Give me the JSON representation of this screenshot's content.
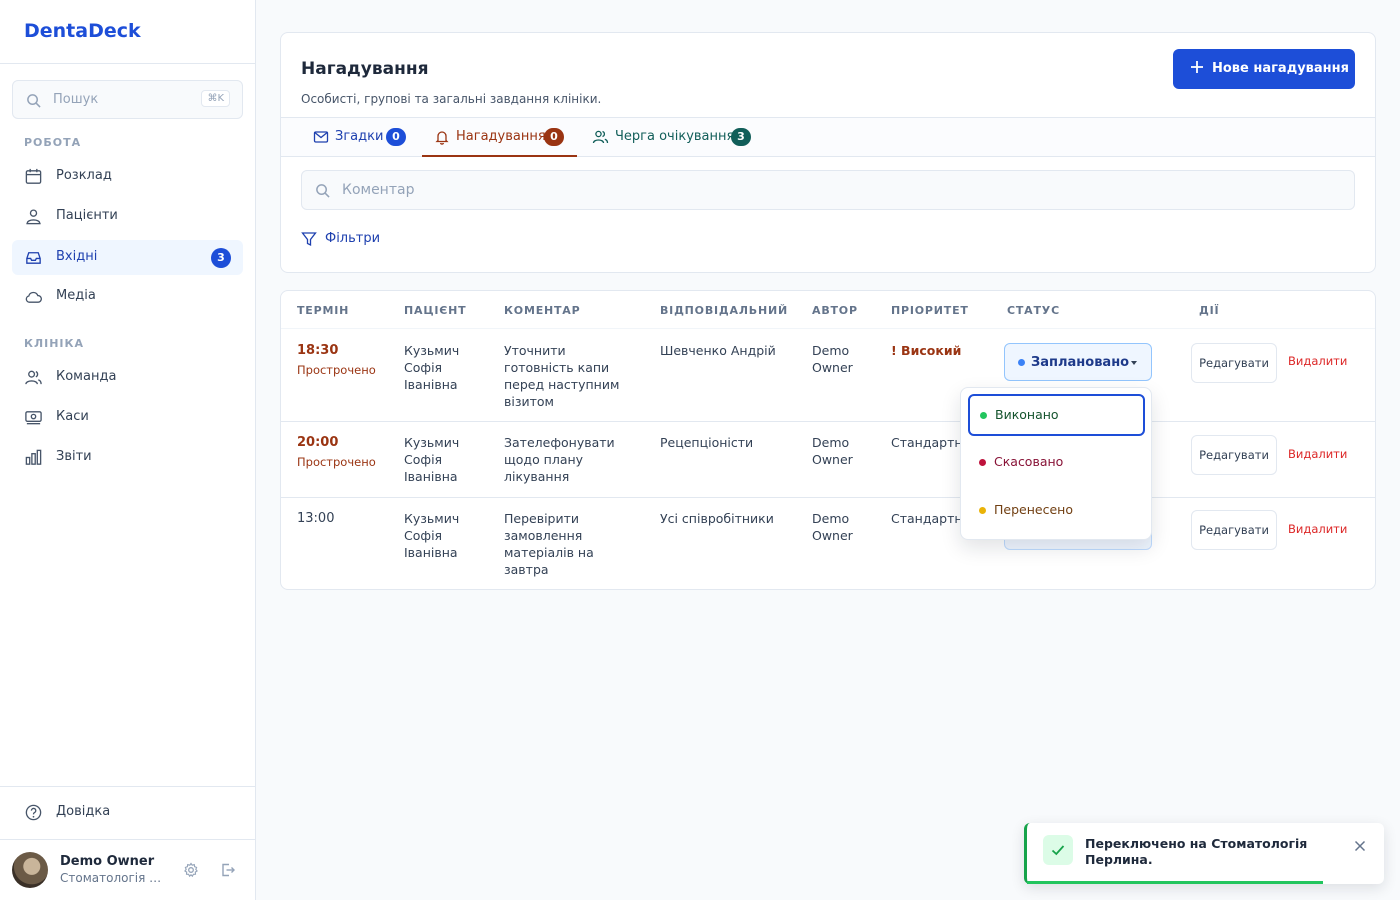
{
  "brand": "DentaDeck",
  "search": {
    "placeholder": "Пошук",
    "shortcut": "⌘K"
  },
  "sidebar": {
    "work_label": "РОБОТА",
    "clinic_label": "КЛІНІКА",
    "items": [
      {
        "label": "Розклад",
        "icon": "calendar-icon"
      },
      {
        "label": "Пацієнти",
        "icon": "patients-icon"
      },
      {
        "label": "Вхідні",
        "icon": "inbox-icon",
        "badge": "3",
        "active": true
      },
      {
        "label": "Медіа",
        "icon": "cloud-icon"
      },
      {
        "label": "Команда",
        "icon": "team-icon"
      },
      {
        "label": "Каси",
        "icon": "cash-icon"
      },
      {
        "label": "Звіти",
        "icon": "reports-icon"
      }
    ],
    "help_label": "Довідка",
    "user": {
      "name": "Demo Owner",
      "clinic": "Стоматологія Перлина"
    }
  },
  "header": {
    "title": "Нагадування",
    "subtitle": "Особисті, групові та загальні завдання клініки.",
    "new_button": "Нове нагадування"
  },
  "tabs": [
    {
      "label": "Згадки",
      "badge": "0",
      "badge_color": "#1d4ed8",
      "color": "#1e40af"
    },
    {
      "label": "Нагадування",
      "badge": "0",
      "badge_color": "#9a3412",
      "color": "#9a3412",
      "active": true
    },
    {
      "label": "Черга очікування",
      "badge": "3",
      "badge_color": "#115e59",
      "color": "#115e59"
    }
  ],
  "comment_search": {
    "placeholder": "Коментар"
  },
  "filters_label": "Фільтри",
  "table": {
    "columns": [
      "ТЕРМІН",
      "ПАЦІЄНТ",
      "КОМЕНТАР",
      "ВІДПОВІДАЛЬНИЙ",
      "АВТОР",
      "ПРІОРИТЕТ",
      "СТАТУС",
      "ДІЇ"
    ],
    "rows": [
      {
        "time": "18:30",
        "overdue": "Прострочено",
        "patient": [
          "Кузьмич",
          "Софія",
          "Іванівна"
        ],
        "comment": [
          "Уточнити",
          "готовність капи",
          "перед наступним",
          "візитом"
        ],
        "responsible": "Шевченко Андрій",
        "author": [
          "Demo",
          "Owner"
        ],
        "priority": "! Високий",
        "status": "Заплановано"
      },
      {
        "time": "20:00",
        "overdue": "Прострочено",
        "patient": [
          "Кузьмич",
          "Софія",
          "Іванівна"
        ],
        "comment": [
          "Зателефонувати",
          "щодо плану",
          "лікування"
        ],
        "responsible": "Рецепціоністи",
        "author": [
          "Demo",
          "Owner"
        ],
        "priority": "Стандартн"
      },
      {
        "time": "13:00",
        "overdue": "",
        "patient": [
          "Кузьмич",
          "Софія",
          "Іванівна"
        ],
        "comment": [
          "Перевірити",
          "замовлення",
          "матеріалів на",
          "завтра"
        ],
        "responsible": "Усі співробітники",
        "author": [
          "Demo",
          "Owner"
        ],
        "priority": "Стандартн"
      }
    ],
    "edit_label": "Редагувати",
    "delete_label": "Видалити"
  },
  "status_dropdown": {
    "options": [
      {
        "label": "Виконано",
        "dot": "#22c55e",
        "color": "#14532d"
      },
      {
        "label": "Скасовано",
        "dot": "#be123c",
        "color": "#881337"
      },
      {
        "label": "Перенесено",
        "dot": "#eab308",
        "color": "#713f12"
      }
    ]
  },
  "toast": {
    "message": "Переключено на Стоматологія Перлина."
  },
  "colors": {
    "accent": "#1d4ed8",
    "overdue": "#9a3412",
    "danger": "#dc2626",
    "success": "#16a34a"
  }
}
